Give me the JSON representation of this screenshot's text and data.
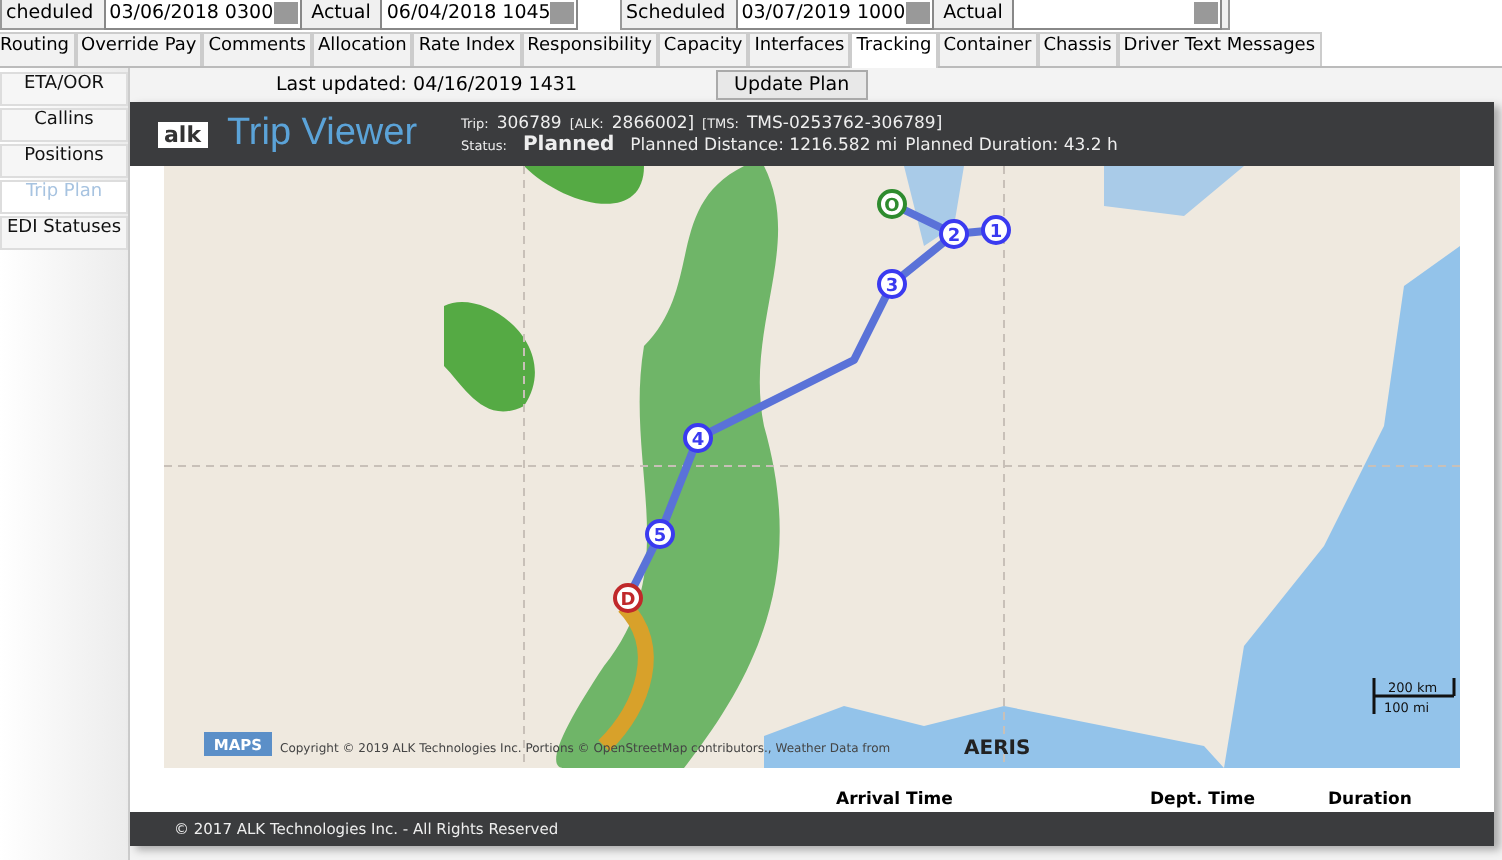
{
  "date_fields": [
    {
      "label": "cheduled",
      "value": "03/06/2018 0300"
    },
    {
      "label": "Actual",
      "value": "06/04/2018 1045"
    },
    {
      "label": "Scheduled",
      "value": "03/07/2019 1000"
    },
    {
      "label": "Actual"
    }
  ],
  "tabs": [
    {
      "label": "Routing",
      "selected": false
    },
    {
      "label": "Override Pay",
      "selected": false
    },
    {
      "label": "Comments",
      "selected": false
    },
    {
      "label": "Allocation",
      "selected": false
    },
    {
      "label": "Rate Index",
      "selected": false
    },
    {
      "label": "Responsibility",
      "selected": false
    },
    {
      "label": "Capacity",
      "selected": false
    },
    {
      "label": "Interfaces",
      "selected": false
    },
    {
      "label": "Tracking",
      "selected": true
    },
    {
      "label": "Container",
      "selected": false
    },
    {
      "label": "Chassis",
      "selected": false
    },
    {
      "label": "Driver Text Messages",
      "selected": false
    }
  ],
  "sidebar": {
    "items": [
      {
        "label": "ETA/OOR",
        "selected": false
      },
      {
        "label": "Callins",
        "selected": false
      },
      {
        "label": "Positions",
        "selected": false
      },
      {
        "label": "Trip Plan",
        "selected": true
      },
      {
        "label": "EDI Statuses",
        "selected": false
      }
    ]
  },
  "last_updated": "Last updated: 04/16/2019 1431",
  "update_button": "Update Plan",
  "viewer": {
    "logo": "alk",
    "title": "Trip Viewer",
    "trip_label": "Trip:",
    "trip": "306789",
    "alk_label": "[ALK:",
    "alk": "2866002]",
    "tms_label": "[TMS:",
    "tms": "TMS-0253762-306789]",
    "status_label": "Status:",
    "status": "Planned",
    "distance": "Planned Distance: 1216.582 mi",
    "duration": "Planned Duration: 43.2 h"
  },
  "map": {
    "stops": [
      {
        "label": "O",
        "kind": "origin"
      },
      {
        "label": "1",
        "kind": "stop"
      },
      {
        "label": "2",
        "kind": "stop"
      },
      {
        "label": "3",
        "kind": "stop"
      },
      {
        "label": "4",
        "kind": "stop"
      },
      {
        "label": "5",
        "kind": "stop"
      },
      {
        "label": "D",
        "kind": "destination"
      }
    ],
    "badge": "MAPS",
    "copyright": "Copyright © 2019 ALK Technologies Inc. Portions © OpenStreetMap contributors., Weather Data from",
    "weather_logo": "AERIS",
    "scale": [
      "200 km",
      "100 mi"
    ]
  },
  "columns": [
    "Arrival Time",
    "Dept. Time",
    "Duration"
  ],
  "footer": "© 2017 ALK Technologies Inc. - All Rights Reserved"
}
